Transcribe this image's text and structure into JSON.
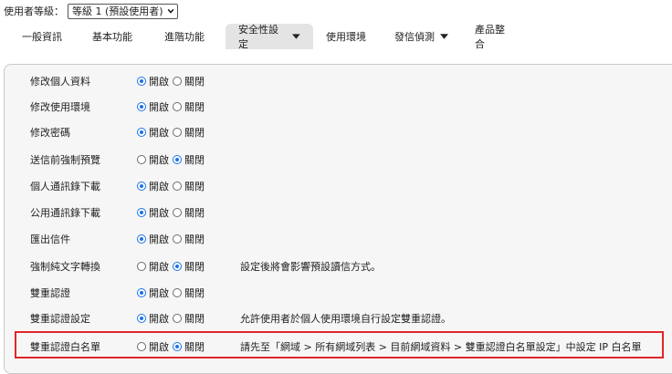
{
  "user_level": {
    "label": "使用者等級：",
    "selected": "等級 1 (預設使用者)"
  },
  "tabs": [
    {
      "label": "一般資訊",
      "dropdown": false
    },
    {
      "label": "基本功能",
      "dropdown": false
    },
    {
      "label": "進階功能",
      "dropdown": false
    },
    {
      "label": "安全性設定",
      "dropdown": true
    },
    {
      "label": "使用環境",
      "dropdown": false
    },
    {
      "label": "發信偵測",
      "dropdown": true
    },
    {
      "label": "產品整合",
      "dropdown": false
    }
  ],
  "options": {
    "on": "開啟",
    "off": "關閉"
  },
  "settings": [
    {
      "name": "修改個人資料",
      "value": "on",
      "desc": ""
    },
    {
      "name": "修改使用環境",
      "value": "on",
      "desc": ""
    },
    {
      "name": "修改密碼",
      "value": "on",
      "desc": ""
    },
    {
      "name": "送信前強制預覽",
      "value": "off",
      "desc": ""
    },
    {
      "name": "個人通訊錄下載",
      "value": "on",
      "desc": ""
    },
    {
      "name": "公用通訊錄下載",
      "value": "on",
      "desc": ""
    },
    {
      "name": "匯出信件",
      "value": "on",
      "desc": ""
    },
    {
      "name": "強制純文字轉換",
      "value": "off",
      "desc": "設定後將會影響預設讀信方式。"
    },
    {
      "name": "雙重認證",
      "value": "on",
      "desc": ""
    },
    {
      "name": "雙重認證設定",
      "value": "on",
      "desc": "允許使用者於個人使用環境自行設定雙重認證。"
    },
    {
      "name": "雙重認證白名單",
      "value": "off",
      "desc": "請先至「網域 > 所有網域列表 > 目前網域資料 > 雙重認證白名單設定」中設定 IP 白名單"
    }
  ],
  "colors": {
    "accent": "#1a73e8",
    "highlight": "#e0262b",
    "active_tab": "#e4e4e4",
    "panel_bg": "#f6f6f6"
  }
}
